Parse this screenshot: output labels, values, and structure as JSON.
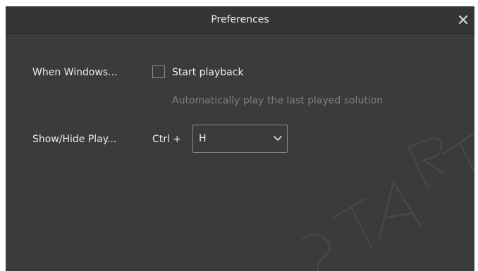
{
  "window": {
    "title": "Preferences",
    "close_icon": "close-icon"
  },
  "startup": {
    "label": "When Windows...",
    "checkbox_label": "Start playback",
    "checked": false,
    "hint": "Automatically play the last played solution"
  },
  "hotkey": {
    "label": "Show/Hide Play...",
    "modifier": "Ctrl +",
    "key": "H"
  },
  "watermark": {
    "text": "STAR T"
  },
  "colors": {
    "background": "#3b3b3b",
    "titlebar": "#353535",
    "text": "#ececec",
    "hint": "#7d7d7d",
    "border": "#8a8a8a"
  }
}
